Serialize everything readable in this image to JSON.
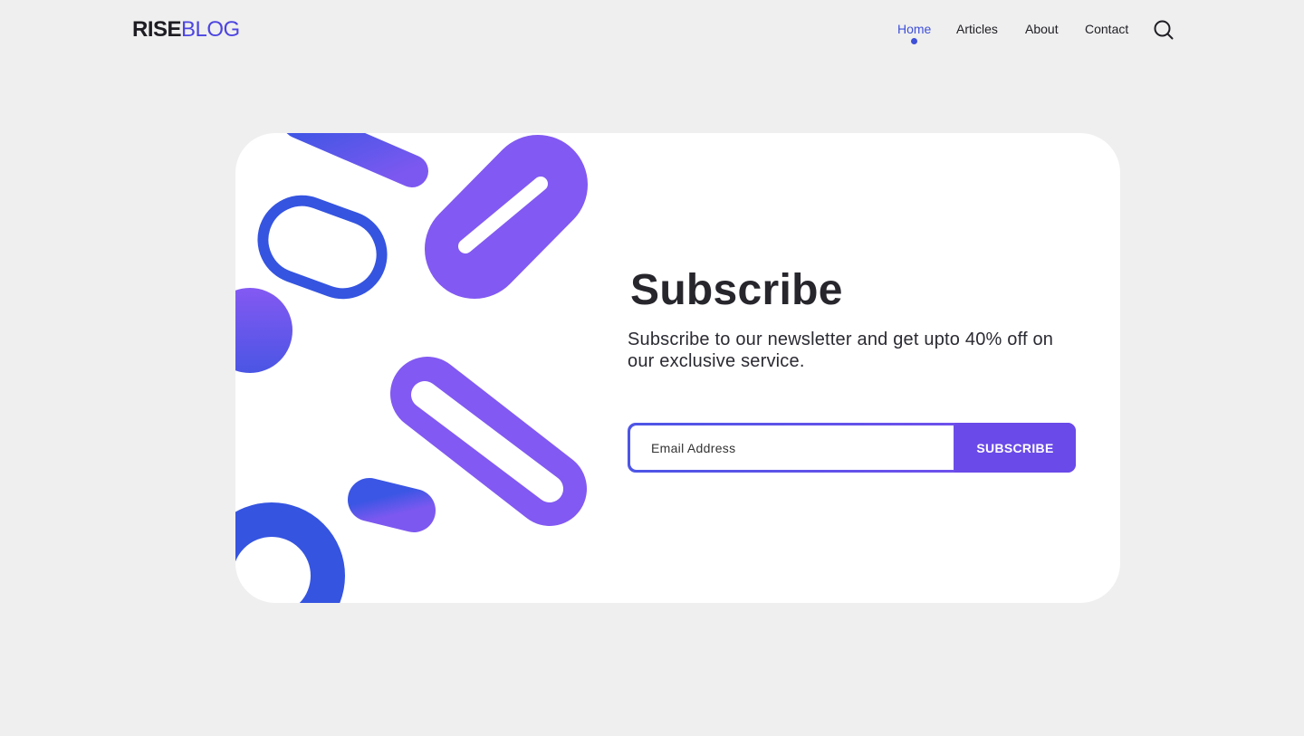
{
  "brand": {
    "part1": "RISE",
    "part2": "BLOG"
  },
  "nav": {
    "items": [
      {
        "label": "Home",
        "active": true
      },
      {
        "label": "Articles",
        "active": false
      },
      {
        "label": "About",
        "active": false
      },
      {
        "label": "Contact",
        "active": false
      }
    ],
    "search_icon": "search-icon"
  },
  "subscribe": {
    "title": "Subscribe",
    "description": "Subscribe to our newsletter and get upto 40% off on our exclusive service.",
    "email_placeholder": "Email Address",
    "button_label": "SUBSCRIBE"
  },
  "colors": {
    "accent": "#4d45e0",
    "purple": "#7f5af0",
    "blue": "#3554e0",
    "background": "#efefef",
    "card": "#ffffff"
  }
}
